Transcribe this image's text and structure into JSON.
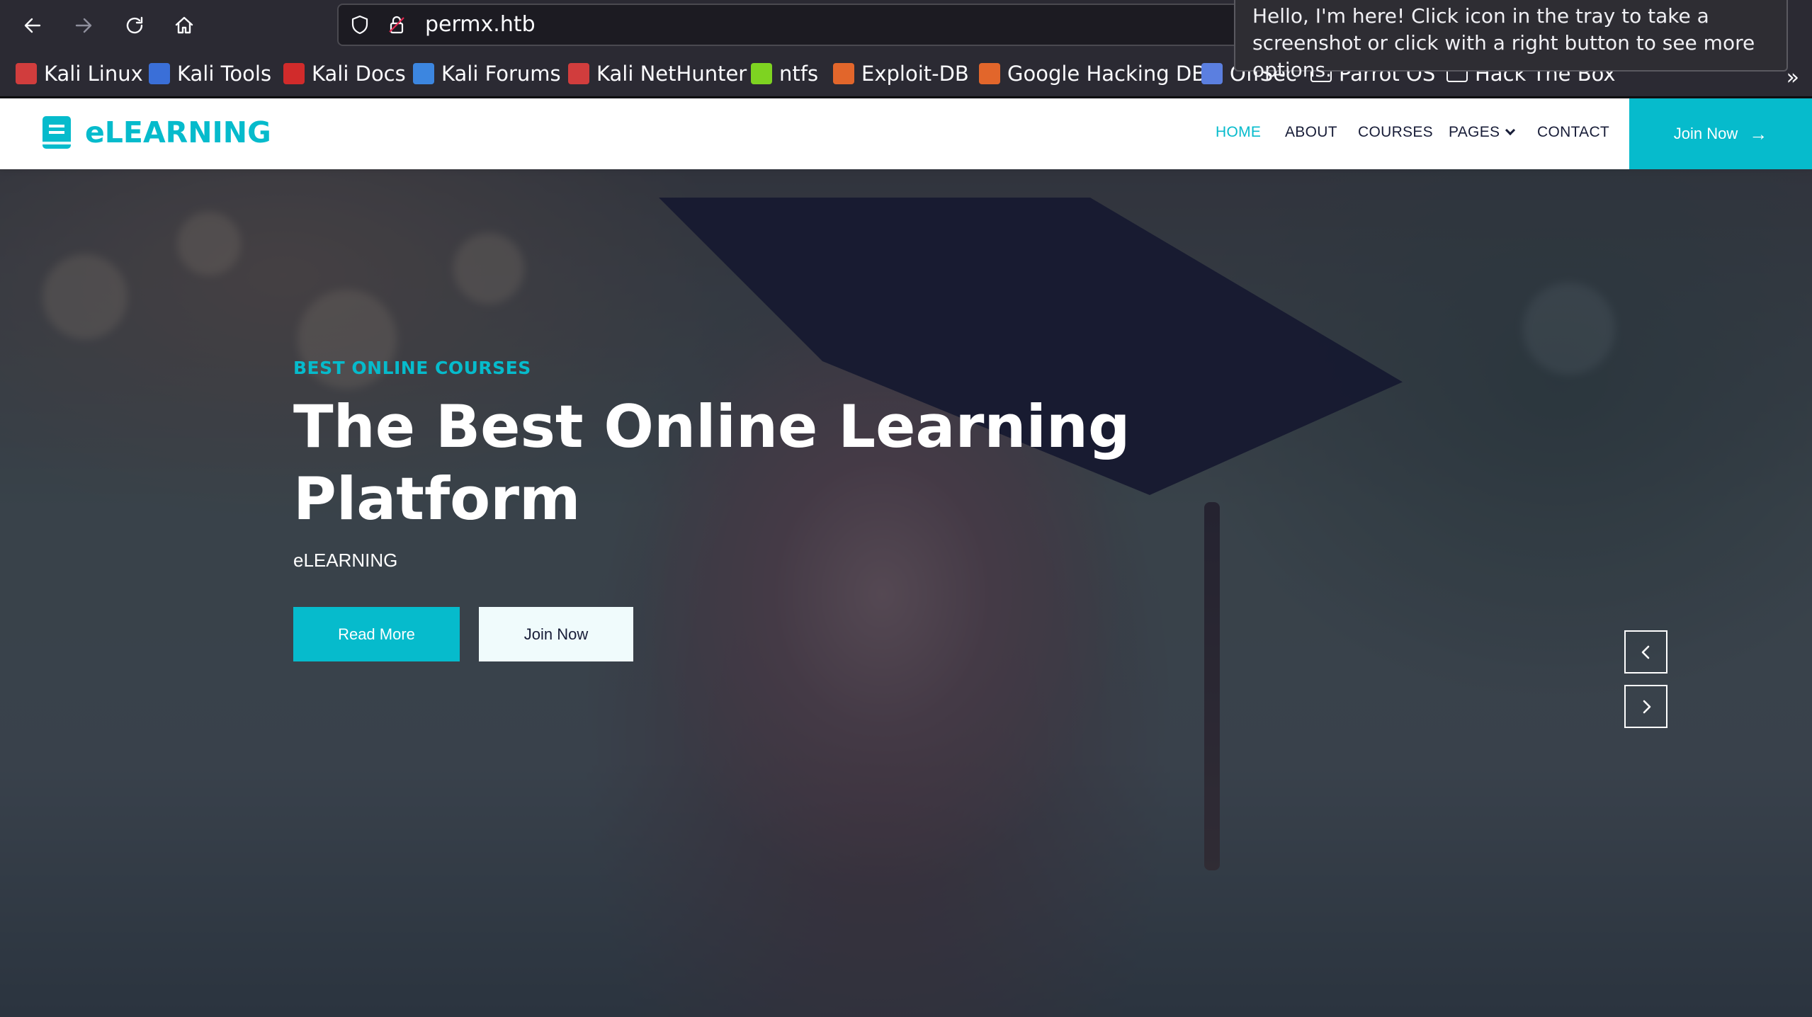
{
  "browser": {
    "url": "permx.htb",
    "bookmarks": [
      {
        "label": "Kali Linux",
        "icon": "kali-dragon-icon",
        "color": "#d13d3d"
      },
      {
        "label": "Kali Tools",
        "icon": "kali-tools-icon",
        "color": "#3a6fd8"
      },
      {
        "label": "Kali Docs",
        "icon": "kali-docs-icon",
        "color": "#d12b2b"
      },
      {
        "label": "Kali Forums",
        "icon": "kali-forums-icon",
        "color": "#3c86e0"
      },
      {
        "label": "Kali NetHunter",
        "icon": "kali-nethunter-icon",
        "color": "#d13d3d"
      },
      {
        "label": "ntfs",
        "icon": "cube-icon",
        "color": "#7ed321"
      },
      {
        "label": "Exploit-DB",
        "icon": "exploit-db-icon",
        "color": "#e2662b"
      },
      {
        "label": "Google Hacking DB",
        "icon": "ghdb-icon",
        "color": "#e2662b"
      },
      {
        "label": "OffSec",
        "icon": "offsec-icon",
        "color": "#5b7fe0"
      },
      {
        "label": "Parrot OS",
        "icon": "folder-icon",
        "color": "#fbfbfe"
      },
      {
        "label": "Hack The Box",
        "icon": "folder-icon",
        "color": "#fbfbfe"
      }
    ],
    "tooltip": "Hello, I'm here! Click icon in the tray to take a screenshot or click with a right button to see more options."
  },
  "site": {
    "brand": "eLEARNING",
    "nav": {
      "home": "HOME",
      "about": "ABOUT",
      "courses": "COURSES",
      "pages": "PAGES",
      "contact": "CONTACT"
    },
    "join_label": "Join Now",
    "accent_color": "#06bbcc"
  },
  "hero": {
    "subtitle": "BEST ONLINE COURSES",
    "headline": "The Best Online Learning Platform",
    "description": "eLEARNING",
    "read_more": "Read More",
    "join_now": "Join Now"
  }
}
